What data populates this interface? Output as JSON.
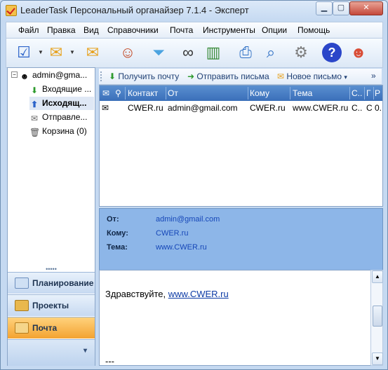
{
  "window": {
    "title": "LeaderTask Персональный органайзер 7.1.4 - Эксперт",
    "minimize_icon": "minimize-icon",
    "maximize_icon": "maximize-icon",
    "close_icon": "close-icon"
  },
  "menu": [
    "Файл",
    "Правка",
    "Вид",
    "Справочники",
    "Почта",
    "Инструменты",
    "Опции",
    "Помощь"
  ],
  "toolbar": {
    "icons": [
      "task-check-icon",
      "mail-icon",
      "mail-add-icon",
      "contacts-icon",
      "filter-funnel-icon",
      "binoculars-icon",
      "chart-icon",
      "printer-icon",
      "preview-magnifier-icon",
      "gear-icon",
      "help-question-icon",
      "people-group-icon"
    ]
  },
  "folders": {
    "account": "admin@gma...",
    "inbox": "Входящие ...",
    "outbox": "Исходящ...",
    "sent": "Отправле...",
    "trash": "Корзина (0)"
  },
  "nav": {
    "grip": "•••••",
    "planning": "Планирование",
    "projects": "Проекты",
    "mail": "Почта",
    "more": "▾"
  },
  "mail_toolbar": {
    "receive": "Получить почту",
    "send": "Отправить письма",
    "new_mail": "Новое письмо",
    "new_mail_caret": "▾",
    "overflow": "»"
  },
  "mail_grid": {
    "columns": [
      "Контакт",
      "От",
      "Кому",
      "Тема",
      "С...",
      "Г",
      "Р"
    ],
    "rows": [
      {
        "contact": "CWER.ru",
        "from": "admin@gmail.com",
        "to": "CWER.ru",
        "subject": "www.CWER.ru",
        "c1": "С...",
        "c2": "С...",
        "c3": "0..."
      }
    ]
  },
  "preview": {
    "from_label": "От:",
    "from_value": "admin@gmail.com",
    "to_label": "Кому:",
    "to_value": "CWER.ru",
    "subject_label": "Тема:",
    "subject_value": "www.CWER.ru"
  },
  "body": {
    "greeting": "Здравствуйте, ",
    "link": "www.CWER.ru",
    "signature": "---"
  },
  "colors": {
    "accent": "#3a6fb9",
    "active_nav": "#f3a331",
    "preview_bg": "#8db6e8"
  }
}
